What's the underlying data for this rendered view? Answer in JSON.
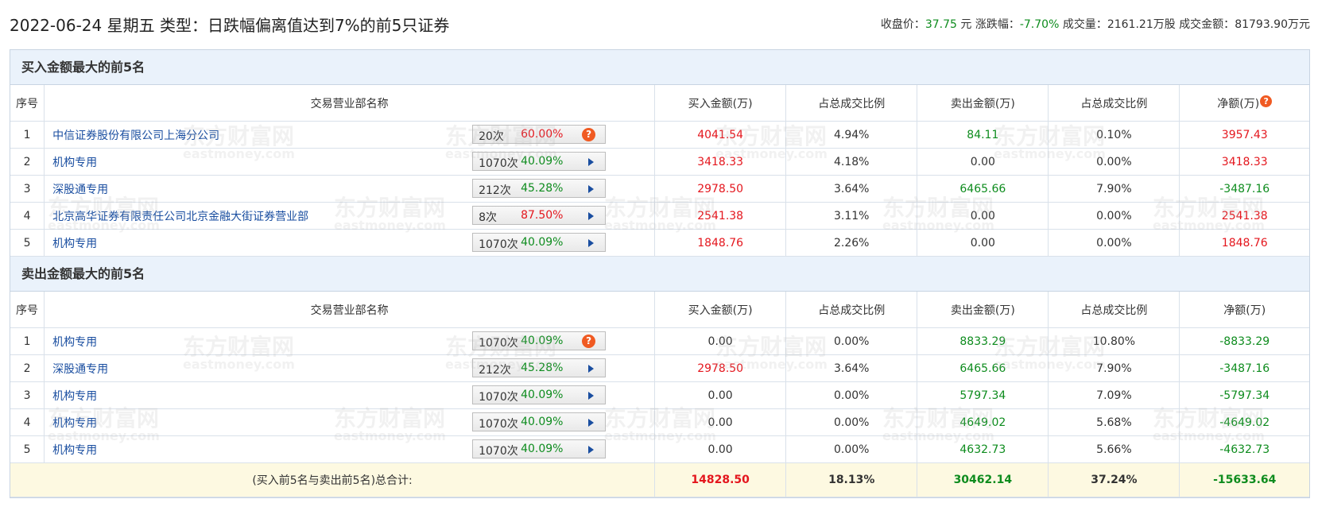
{
  "header": {
    "title": "2022-06-24 星期五 类型：日跌幅偏离值达到7%的前5只证券",
    "close_label": "收盘价：",
    "close_value": "37.75",
    "close_unit": "元",
    "change_label": "涨跌幅：",
    "change_value": "-7.70%",
    "volume_label": "成交量：",
    "volume_value": "2161.21万股",
    "amount_label": "成交金额：",
    "amount_value": "81793.90万元"
  },
  "columns": {
    "seq": "序号",
    "name": "交易营业部名称",
    "buy": "买入金额(万)",
    "buy_ratio": "占总成交比例",
    "sell": "卖出金额(万)",
    "sell_ratio": "占总成交比例",
    "net": "净额(万)"
  },
  "buy_section": {
    "title": "买入金额最大的前5名",
    "rows": [
      {
        "seq": "1",
        "name": "中信证券股份有限公司上海分公司",
        "count": "20次",
        "rate": "60.00%",
        "rate_color": "red",
        "icon": "help-icon",
        "buy": "4041.54",
        "buy_ratio": "4.94%",
        "sell": "84.11",
        "sell_ratio": "0.10%",
        "net": "3957.43",
        "net_color": "red"
      },
      {
        "seq": "2",
        "name": "机构专用",
        "count": "1070次",
        "rate": "40.09%",
        "rate_color": "green",
        "icon": "arrow-right-icon",
        "buy": "3418.33",
        "buy_ratio": "4.18%",
        "sell": "0.00",
        "sell_ratio": "0.00%",
        "net": "3418.33",
        "net_color": "red"
      },
      {
        "seq": "3",
        "name": "深股通专用",
        "count": "212次",
        "rate": "45.28%",
        "rate_color": "green",
        "icon": "arrow-right-icon",
        "buy": "2978.50",
        "buy_ratio": "3.64%",
        "sell": "6465.66",
        "sell_ratio": "7.90%",
        "net": "-3487.16",
        "net_color": "green"
      },
      {
        "seq": "4",
        "name": "北京高华证券有限责任公司北京金融大街证券营业部",
        "count": "8次",
        "rate": "87.50%",
        "rate_color": "red",
        "icon": "arrow-right-icon",
        "buy": "2541.38",
        "buy_ratio": "3.11%",
        "sell": "0.00",
        "sell_ratio": "0.00%",
        "net": "2541.38",
        "net_color": "red"
      },
      {
        "seq": "5",
        "name": "机构专用",
        "count": "1070次",
        "rate": "40.09%",
        "rate_color": "green",
        "icon": "arrow-right-icon",
        "buy": "1848.76",
        "buy_ratio": "2.26%",
        "sell": "0.00",
        "sell_ratio": "0.00%",
        "net": "1848.76",
        "net_color": "red"
      }
    ]
  },
  "sell_section": {
    "title": "卖出金额最大的前5名",
    "rows": [
      {
        "seq": "1",
        "name": "机构专用",
        "count": "1070次",
        "rate": "40.09%",
        "rate_color": "green",
        "icon": "help-icon",
        "buy": "0.00",
        "buy_color": "",
        "buy_ratio": "0.00%",
        "sell": "8833.29",
        "sell_ratio": "10.80%",
        "net": "-8833.29",
        "net_color": "green"
      },
      {
        "seq": "2",
        "name": "深股通专用",
        "count": "212次",
        "rate": "45.28%",
        "rate_color": "green",
        "icon": "arrow-right-icon",
        "buy": "2978.50",
        "buy_color": "red",
        "buy_ratio": "3.64%",
        "sell": "6465.66",
        "sell_ratio": "7.90%",
        "net": "-3487.16",
        "net_color": "green"
      },
      {
        "seq": "3",
        "name": "机构专用",
        "count": "1070次",
        "rate": "40.09%",
        "rate_color": "green",
        "icon": "arrow-right-icon",
        "buy": "0.00",
        "buy_color": "",
        "buy_ratio": "0.00%",
        "sell": "5797.34",
        "sell_ratio": "7.09%",
        "net": "-5797.34",
        "net_color": "green"
      },
      {
        "seq": "4",
        "name": "机构专用",
        "count": "1070次",
        "rate": "40.09%",
        "rate_color": "green",
        "icon": "arrow-right-icon",
        "buy": "0.00",
        "buy_color": "",
        "buy_ratio": "0.00%",
        "sell": "4649.02",
        "sell_ratio": "5.68%",
        "net": "-4649.02",
        "net_color": "green"
      },
      {
        "seq": "5",
        "name": "机构专用",
        "count": "1070次",
        "rate": "40.09%",
        "rate_color": "green",
        "icon": "arrow-right-icon",
        "buy": "0.00",
        "buy_color": "",
        "buy_ratio": "0.00%",
        "sell": "4632.73",
        "sell_ratio": "5.66%",
        "net": "-4632.73",
        "net_color": "green"
      }
    ]
  },
  "total": {
    "label": "(买入前5名与卖出前5名)总合计:",
    "buy": "14828.50",
    "buy_ratio": "18.13%",
    "sell": "30462.14",
    "sell_ratio": "37.24%",
    "net": "-15633.64"
  },
  "watermark": {
    "cn": "东方财富网",
    "en": "eastmoney.com"
  },
  "colors": {
    "red": "#e4161d",
    "green": "#0e8c1e",
    "link": "#1a4ea0",
    "section_bg": "#eaf2fb",
    "total_bg": "#fdf9e1"
  }
}
